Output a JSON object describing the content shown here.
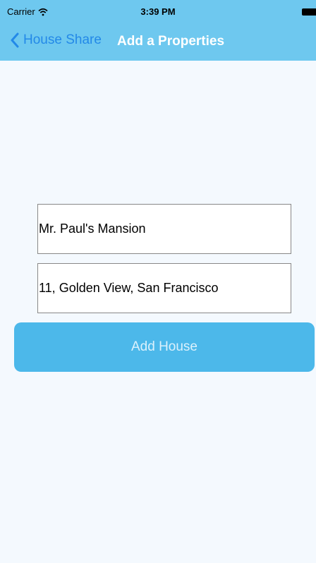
{
  "status_bar": {
    "carrier": "Carrier",
    "time": "3:39 PM"
  },
  "nav": {
    "back_label": "House Share",
    "title": "Add a Properties"
  },
  "form": {
    "name_value": "Mr. Paul's Mansion",
    "address_value": "11, Golden View, San Francisco",
    "submit_label": "Add House"
  },
  "colors": {
    "nav_background": "#6ec8ef",
    "back_link": "#2389e8",
    "button_background": "#4cb8ea",
    "page_background": "#f4f9fe"
  }
}
